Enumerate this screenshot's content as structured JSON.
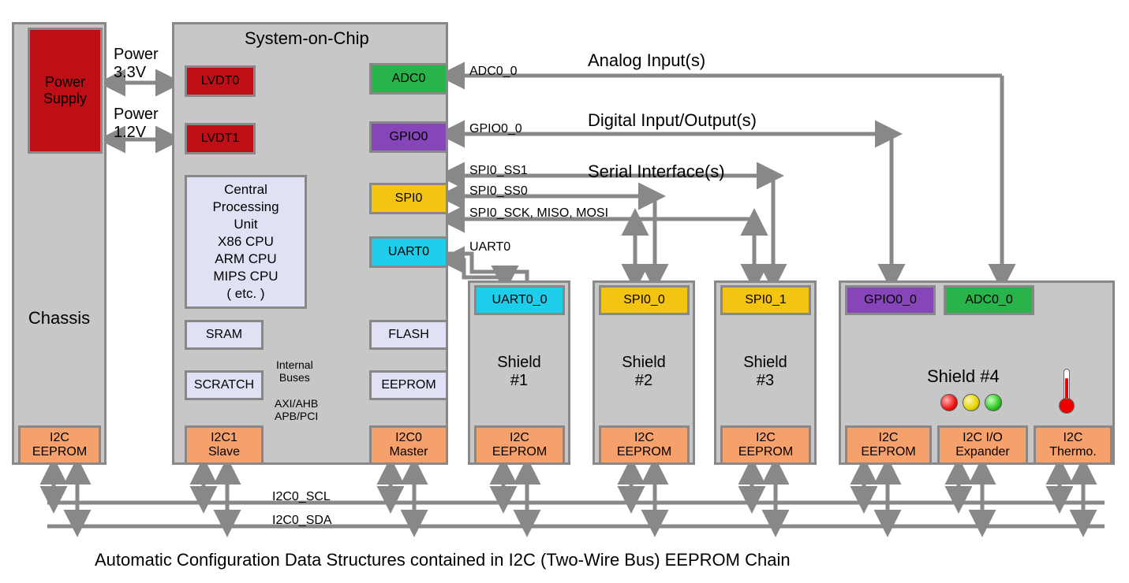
{
  "chassis": {
    "title": "Chassis",
    "power": "Power\nSupply",
    "eeprom": "I2C\nEEPROM"
  },
  "power_labels": {
    "p33": "Power\n3.3V",
    "p12": "Power\n1.2V"
  },
  "soc": {
    "title": "System-on-Chip",
    "lvdt0": "LVDT0",
    "lvdt1": "LVDT1",
    "cpu": "Central\nProcessing\nUnit\nX86 CPU\nARM CPU\nMIPS CPU\n( etc. )",
    "sram": "SRAM",
    "scratch": "SCRATCH",
    "internal_buses": "Internal\nBuses",
    "bus_names": "AXI/AHB\nAPB/PCI",
    "adc0": "ADC0",
    "gpio0": "GPIO0",
    "spi0": "SPI0",
    "uart0": "UART0",
    "flash": "FLASH",
    "eeprom": "EEPROM",
    "i2c1": "I2C1\nSlave",
    "i2c0": "I2C0\nMaster"
  },
  "signals": {
    "adc0_0": "ADC0_0",
    "analog": "Analog Input(s)",
    "gpio0_0": "GPIO0_0",
    "digital": "Digital Input/Output(s)",
    "spi0_ss1": "SPI0_SS1",
    "spi0_ss0": "SPI0_SS0",
    "serial": "Serial Interface(s)",
    "spi_bus": "SPI0_SCK, MISO, MOSI",
    "uart0": "UART0",
    "i2c_scl": "I2C0_SCL",
    "i2c_sda": "I2C0_SDA"
  },
  "shields": {
    "s1": {
      "title": "Shield\n#1",
      "port": "UART0_0",
      "eeprom": "I2C\nEEPROM"
    },
    "s2": {
      "title": "Shield\n#2",
      "port": "SPI0_0",
      "eeprom": "I2C\nEEPROM"
    },
    "s3": {
      "title": "Shield\n#3",
      "port": "SPI0_1",
      "eeprom": "I2C\nEEPROM"
    },
    "s4": {
      "title": "Shield  #4",
      "gpio": "GPIO0_0",
      "adc": "ADC0_0",
      "eeprom": "I2C\nEEPROM",
      "io": "I2C I/O\nExpander",
      "thermo": "I2C\nThermo."
    }
  },
  "caption": "Automatic Configuration Data Structures contained in I2C (Two-Wire Bus) EEPROM Chain"
}
